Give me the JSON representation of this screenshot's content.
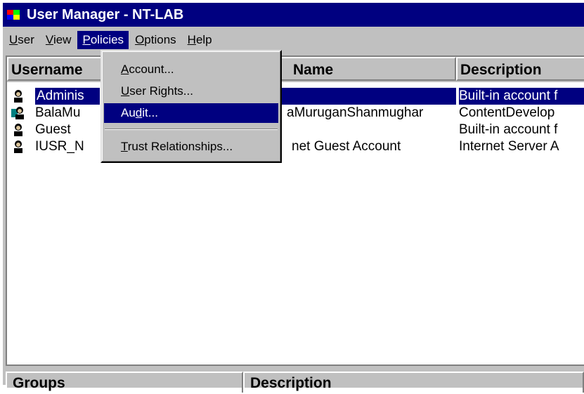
{
  "window": {
    "title": "User Manager - NT-LAB",
    "icon": "user-manager-icon"
  },
  "menubar": [
    {
      "label": "User",
      "accel": "U",
      "rest": "ser"
    },
    {
      "label": "View",
      "accel": "V",
      "rest": "iew"
    },
    {
      "label": "Policies",
      "accel": "P",
      "rest": "olicies",
      "active": true
    },
    {
      "label": "Options",
      "accel": "O",
      "rest": "ptions"
    },
    {
      "label": "Help",
      "accel": "H",
      "rest": "elp"
    }
  ],
  "columns": {
    "username": "Username",
    "fullname": "Name",
    "description": "Description"
  },
  "users": [
    {
      "username": "Adminis",
      "fullname": "",
      "description": "Built-in account f",
      "selected": true
    },
    {
      "username": "BalaMu",
      "fullname": "aMuruganShanmughar",
      "description": "ContentDevelop"
    },
    {
      "username": "Guest",
      "fullname": "",
      "description": "Built-in account f"
    },
    {
      "username": "IUSR_N",
      "fullname": "net Guest Account",
      "description": "Internet Server A"
    }
  ],
  "policies_menu": {
    "account": {
      "accel": "A",
      "rest": "ccount..."
    },
    "user_rights": {
      "accel": "U",
      "rest": "ser Rights..."
    },
    "audit": {
      "pre": "Au",
      "accel": "d",
      "rest": "it..."
    },
    "trust": {
      "accel": "T",
      "rest": "rust Relationships..."
    }
  },
  "bottom": {
    "groups": "Groups",
    "description": "Description"
  },
  "colors": {
    "titlebar": "#000080",
    "face": "#c0c0c0",
    "highlight": "#000080"
  }
}
